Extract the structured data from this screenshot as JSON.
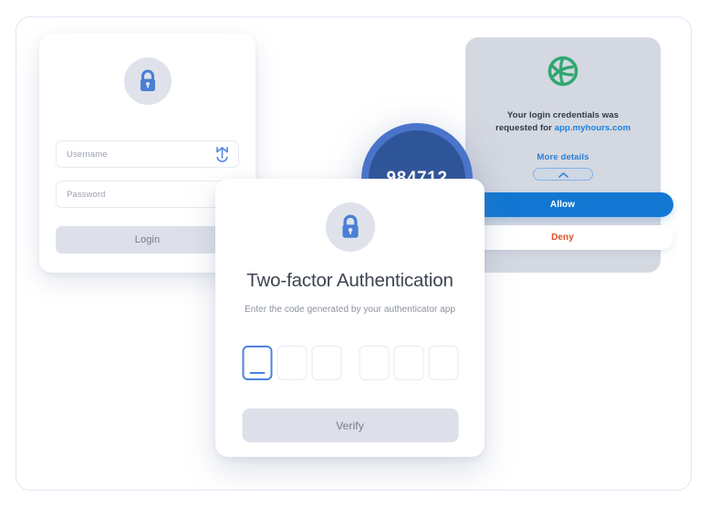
{
  "frame": {
    "background": "#ffffff",
    "border_color": "#dfe6f3"
  },
  "login_card": {
    "icon": "lock-icon",
    "username_placeholder": "Username",
    "username_icon": "fingerprint-icon",
    "password_placeholder": "Password",
    "password_icon": "fingerprint-icon",
    "login_label": "Login"
  },
  "code_badge": {
    "code": "984712",
    "ring_color": "#4a74c9",
    "fill_color": "#2f5599",
    "progress_color": "#f58220",
    "progress_start_deg": 160,
    "progress_end_deg": 268
  },
  "notification": {
    "icon": "globe-icon",
    "icon_color": "#2fa772",
    "message_line1": "Your login credentials was",
    "message_line2_prefix": "requested for ",
    "message_link": "app.myhours.com",
    "link_color": "#1d7fe0",
    "more_details_label": "More details",
    "more_details_icon": "chevron-up-icon",
    "allow_label": "Allow",
    "allow_color": "#1277d3",
    "deny_label": "Deny",
    "deny_color": "#df4f2e",
    "panel_color": "#d4d8e1"
  },
  "two_factor": {
    "icon": "lock-icon",
    "title": "Two-factor Authentication",
    "subtitle": "Enter the code generated by your authenticator app",
    "otp_boxes": [
      "",
      "",
      "",
      "",
      "",
      ""
    ],
    "otp_active_index": 0,
    "otp_focus_color": "#4a82e0",
    "verify_label": "Verify"
  }
}
